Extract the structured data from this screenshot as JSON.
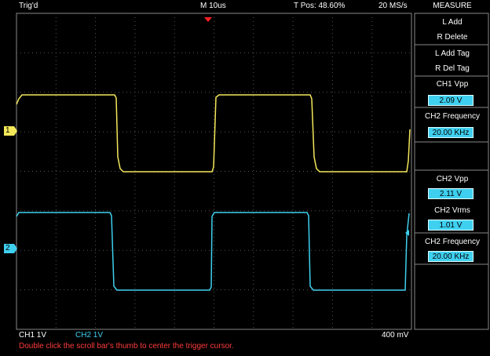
{
  "header": {
    "status": "Trig'd",
    "timebase": "M 10us",
    "tpos": "T Pos: 48.60%",
    "sample_rate": "20 MS/s",
    "panel_title": "MEASURE"
  },
  "panel": {
    "l_add": "L Add",
    "r_delete": "R Delete",
    "l_add_tag": "L Add Tag",
    "r_del_tag": "R Del Tag",
    "measurements": [
      {
        "label": "CH1 Vpp",
        "value": "2.09 V"
      },
      {
        "label": "CH2 Frequency",
        "value": "20.00 KHz"
      },
      {
        "label": "CH2 Vpp",
        "value": "2.11 V"
      },
      {
        "label": "CH2 Vrms",
        "value": "1.01 V"
      },
      {
        "label": "CH2 Frequency",
        "value": "20.00 KHz"
      }
    ]
  },
  "channels": {
    "ch1_marker": "1",
    "ch2_marker": "2",
    "ch1_scale": "CH1  1V",
    "ch2_scale": "CH2  1V",
    "ch1_color": "#f4e85a",
    "ch2_color": "#3fd0f0"
  },
  "footer": {
    "cursor_value": "400 mV",
    "hint": "Double click the scroll bar's thumb to center the trigger cursor."
  },
  "colors": {
    "grid": "#555555",
    "hint": "#ff3b3b",
    "trigger": "#ff2020"
  }
}
